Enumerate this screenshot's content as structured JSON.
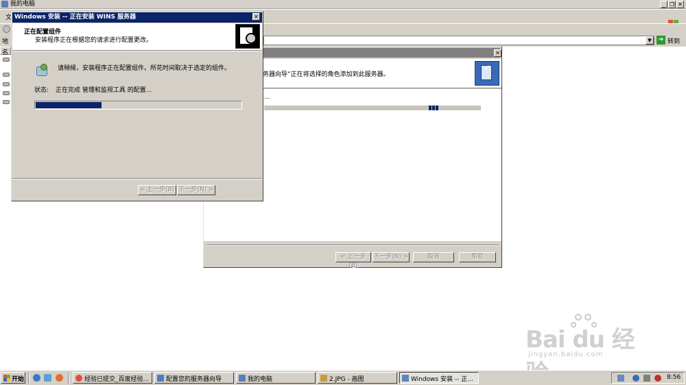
{
  "explorer": {
    "title": "我的电脑",
    "menu_partial": "文",
    "address_label": "地",
    "go_label": "转到",
    "header_partial": "名"
  },
  "wizard": {
    "header_text": "务器向导”正在将选择的角色添加到此服务器。",
    "status_dots": "...",
    "buttons": {
      "back": "< 上一步(B)",
      "next": "下一步(N) >",
      "cancel": "取消",
      "help": "帮助"
    }
  },
  "setup": {
    "title": "Windows 安装 -- 正在安装 WINS 服务器",
    "header_title": "正在配置组件",
    "header_subtitle": "安装程序正在根据您的请求进行配置更改。",
    "message": "请稍候，安装程序正在配置组件。所花时间取决于选定的组件。",
    "status_label": "状态:",
    "status_text": "正在完成 管理和监视工具 的配置...",
    "progress_percent": 32,
    "buttons": {
      "back": "< 上一步(B)",
      "next": "下一步(N) >"
    }
  },
  "watermark": {
    "main": "Bai du 经验",
    "sub": "jingyan.baidu.com"
  },
  "taskbar": {
    "start_label": "开始",
    "tasks": [
      {
        "label": "经验已提交_百度经验..."
      },
      {
        "label": "配置您的服务器向导"
      },
      {
        "label": "我的电脑"
      },
      {
        "label": "2.JPG - 画图"
      },
      {
        "label": "Windows 安装 -- 正..."
      }
    ],
    "clock": "8:56"
  },
  "colors": {
    "title_active": "#0a246a",
    "title_inactive": "#808080",
    "face": "#d4d0c8",
    "progress": "#0a246a"
  }
}
